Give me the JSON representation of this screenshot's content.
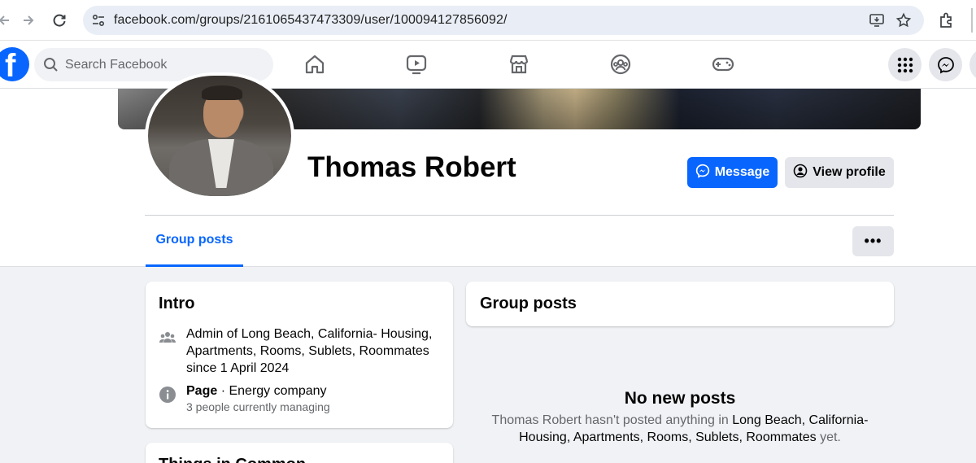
{
  "browser": {
    "url": "facebook.com/groups/2161065437473309/user/100094127856092/"
  },
  "header": {
    "search_placeholder": "Search Facebook",
    "logo_letter": "f"
  },
  "profile": {
    "name": "Thomas Robert",
    "message_label": "Message",
    "view_profile_label": "View profile",
    "tab_label": "Group posts",
    "more_label": "•••"
  },
  "intro": {
    "title": "Intro",
    "admin_prefix": "Admin of ",
    "group_name": "Long Beach, California- Housing, Apartments, Rooms, Sublets, Roommates",
    "admin_since": "since 1 April 2024",
    "page_label": "Page",
    "page_category": " · Energy company",
    "page_sub": "3 people currently managing"
  },
  "things": {
    "title": "Things in Common"
  },
  "group_posts": {
    "title": "Group posts",
    "empty_title": "No new posts",
    "empty_prefix": "Thomas Robert hasn't posted anything in ",
    "empty_group": "Long Beach, California- Housing, Apartments, Rooms, Sublets, Roommates",
    "empty_suffix": " yet."
  },
  "colors": {
    "accent": "#0866ff",
    "background": "#f0f2f5",
    "secondary_text": "#65676b"
  }
}
